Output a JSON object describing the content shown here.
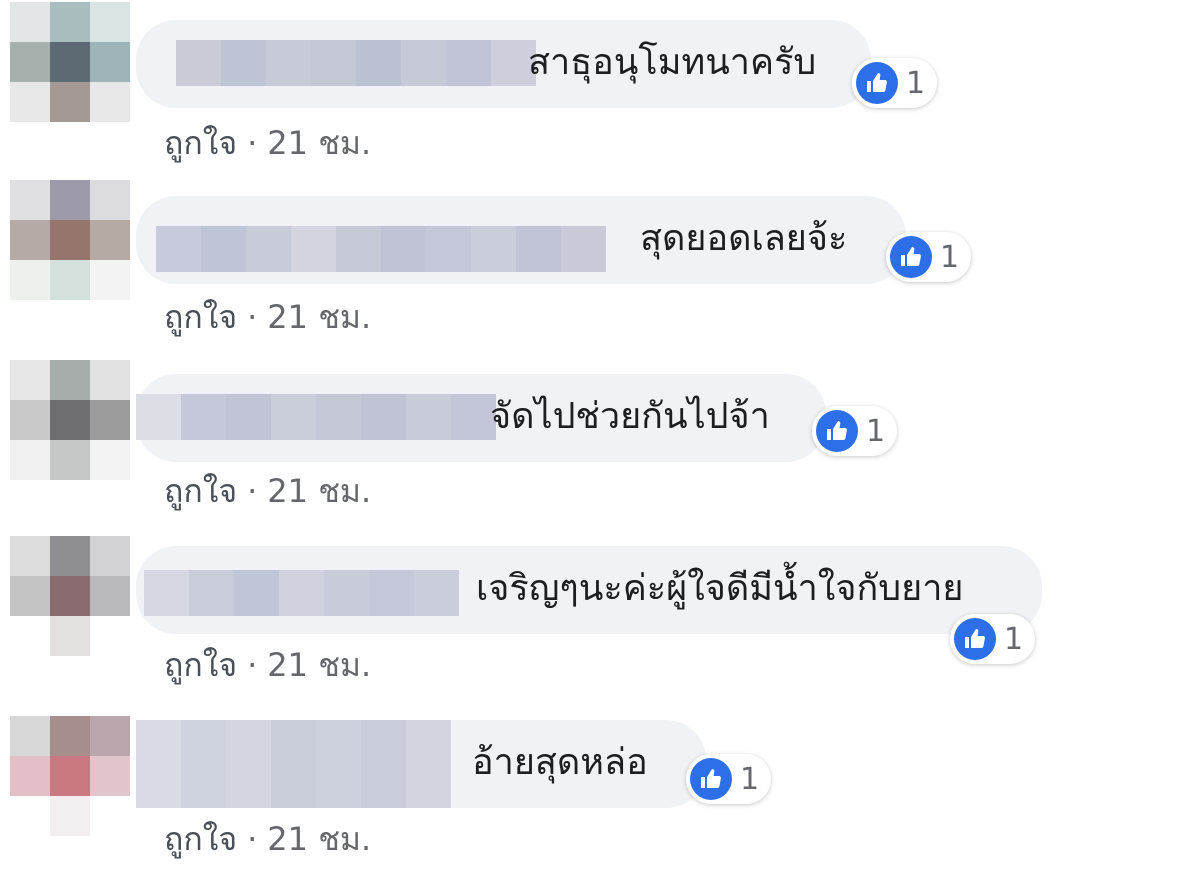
{
  "comments": [
    {
      "text": "สาธุอนุโมทนาครับ",
      "like_count": "1",
      "like_label": "ถูกใจ",
      "separator": "·",
      "time": "21 ชม."
    },
    {
      "text": "สุดยอดเลยจ้ะ",
      "like_count": "1",
      "like_label": "ถูกใจ",
      "separator": "·",
      "time": "21 ชม."
    },
    {
      "text": "จัดไปช่วยกันไปจ้า",
      "like_count": "1",
      "like_label": "ถูกใจ",
      "separator": "·",
      "time": "21 ชม."
    },
    {
      "text": "เจริญๆนะค่ะผู้ใจดีมีน้ำใจกับยาย",
      "like_count": "1",
      "like_label": "ถูกใจ",
      "separator": "·",
      "time": "21 ชม."
    },
    {
      "text": "อ้ายสุดหล่อ",
      "like_count": "1",
      "like_label": "ถูกใจ",
      "separator": "·",
      "time": "21 ชม."
    }
  ],
  "colors": {
    "bubble": "#f0f2f5",
    "like_icon": "#2d6fe8",
    "meta_text": "#65676b"
  },
  "icons": {
    "reaction": "thumbs-up-icon"
  }
}
